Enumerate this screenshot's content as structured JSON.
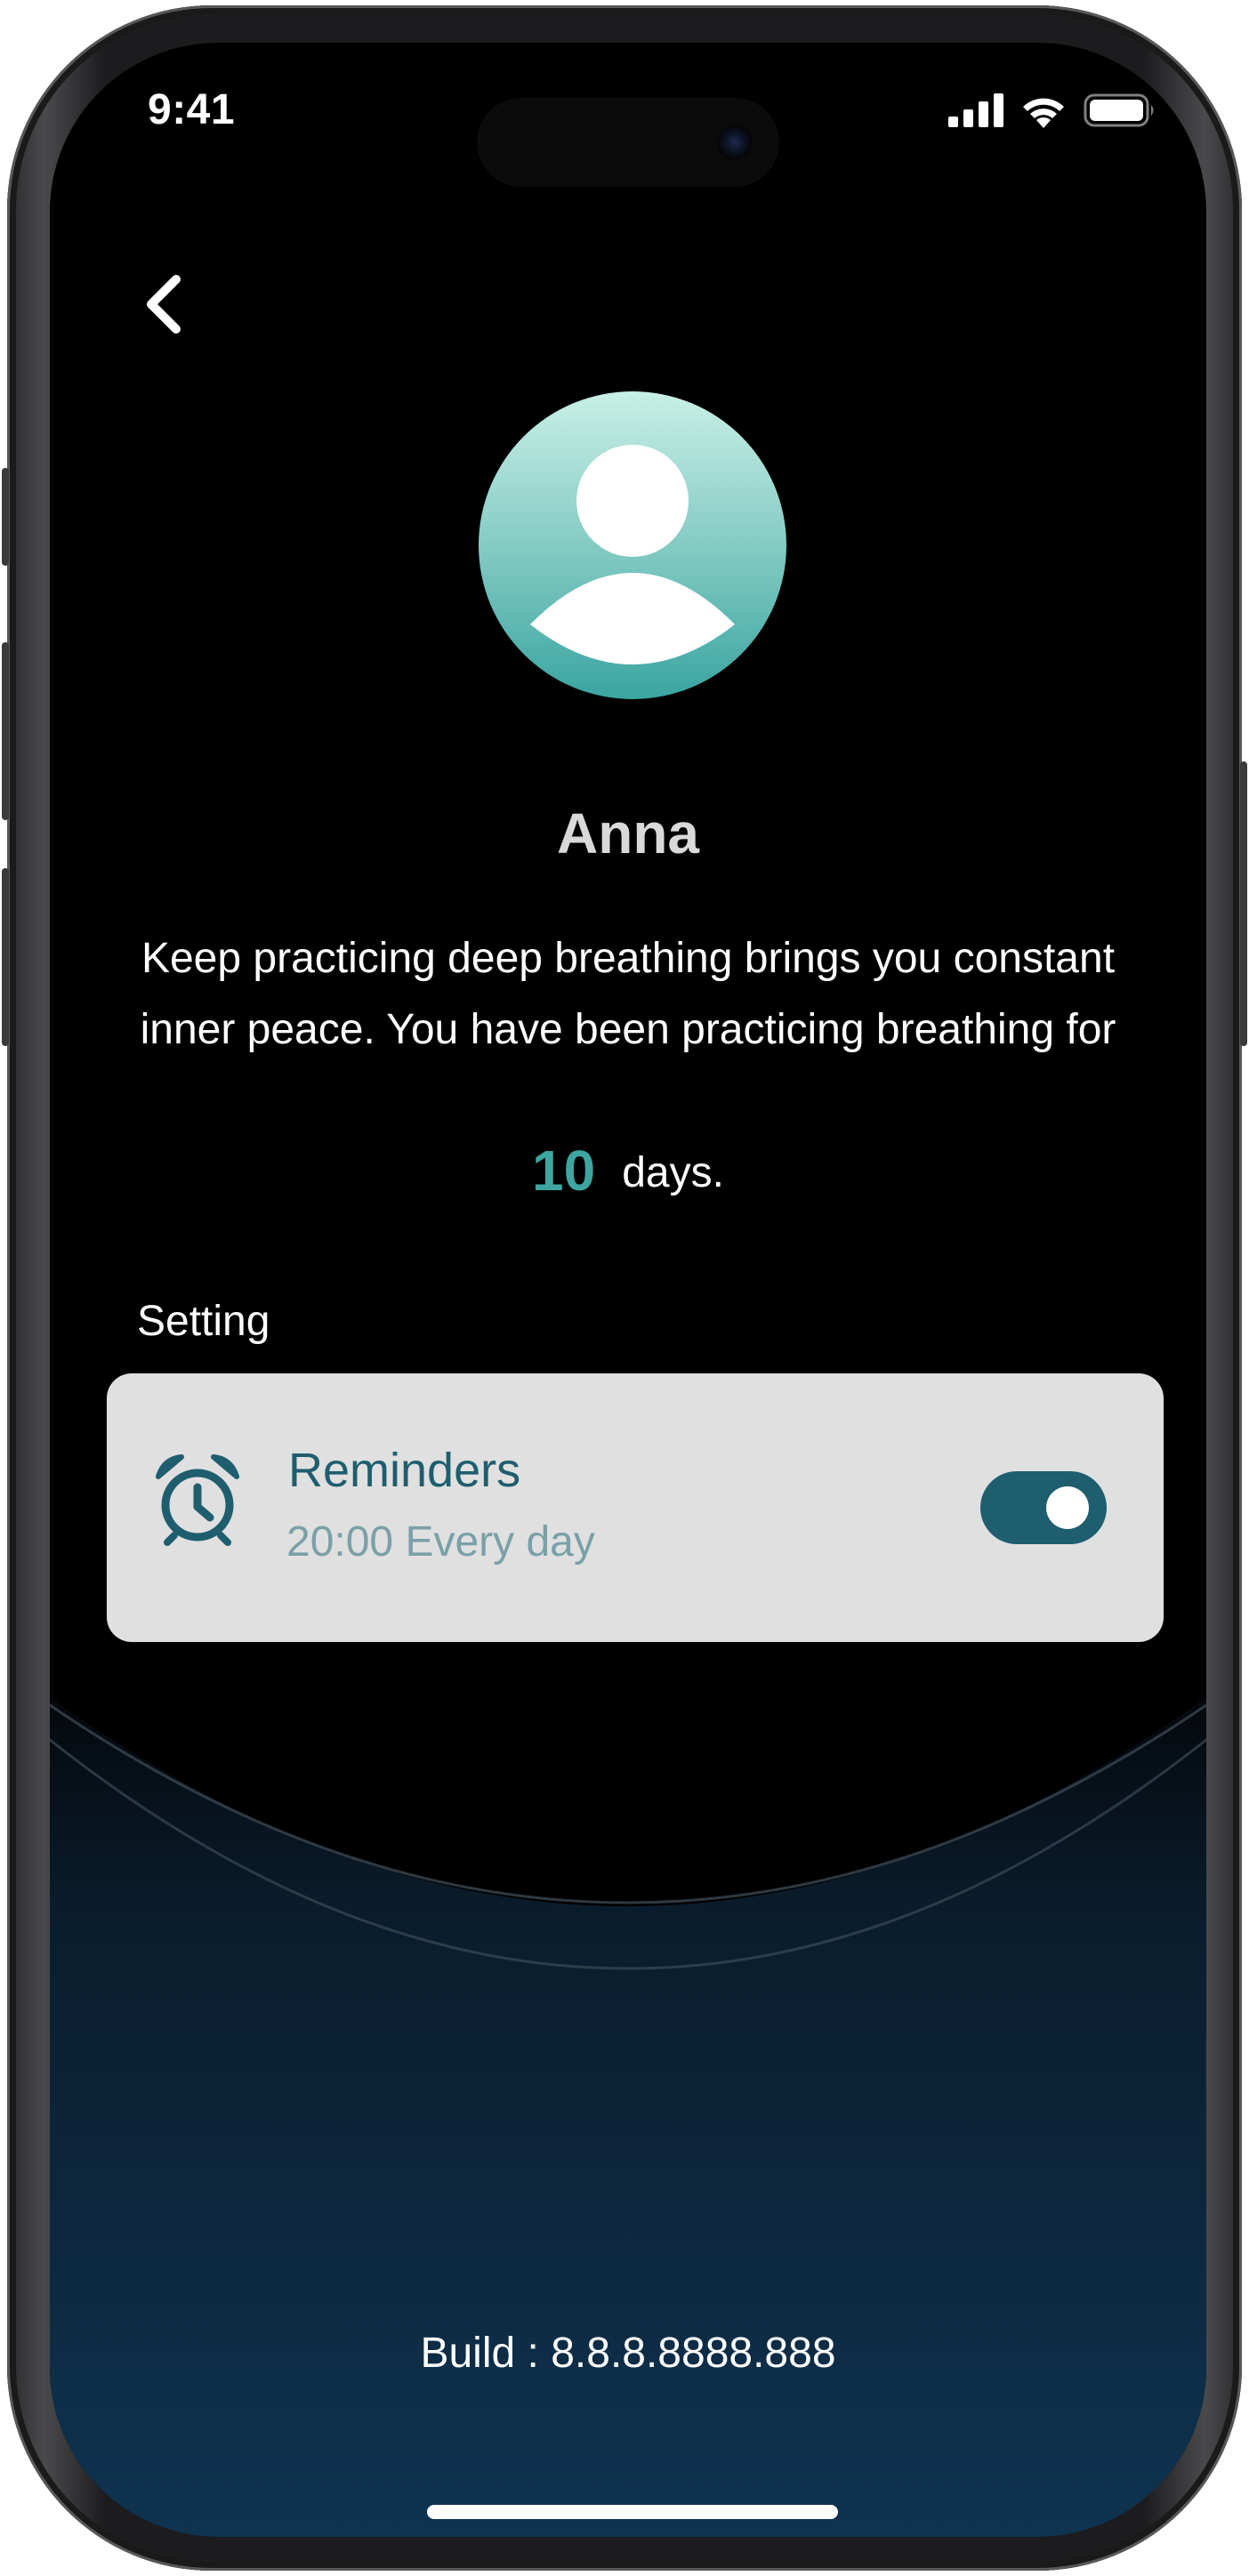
{
  "status_bar": {
    "time": "9:41",
    "icons": [
      "signal-icon",
      "wifi-icon",
      "battery-icon"
    ]
  },
  "nav": {
    "back_icon": "chevron-left-icon"
  },
  "profile": {
    "avatar_icon": "user-silhouette-icon",
    "name": "Anna",
    "message": "Keep practicing deep breathing brings you constant inner peace. You have been practicing breathing for",
    "days_count": "10",
    "days_label": "days."
  },
  "settings": {
    "section_title": "Setting",
    "reminder": {
      "icon": "alarm-clock-icon",
      "title": "Reminders",
      "subtitle": "20:00 Every day",
      "enabled": true
    }
  },
  "footer": {
    "build": "Build : 8.8.8.8888.888"
  },
  "colors": {
    "accent_teal": "#3ea6a0",
    "reminder_teal": "#1e5e6e",
    "background": "#000000",
    "bottom_gradient": "#0f3350"
  }
}
